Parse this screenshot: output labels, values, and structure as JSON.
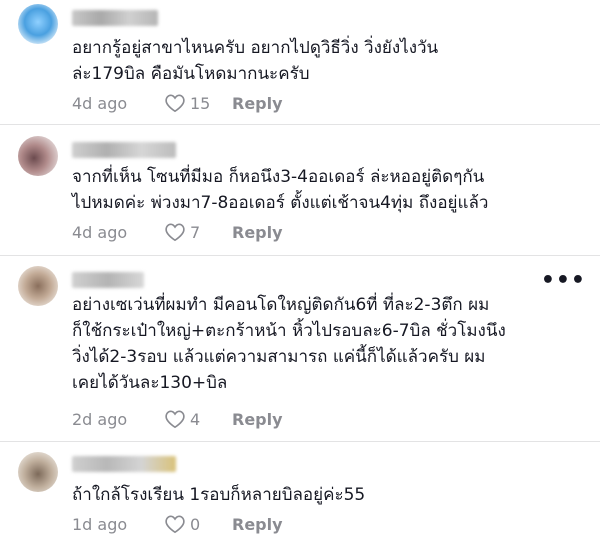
{
  "comments": [
    {
      "text_line1": "อยากรู้อยู่สาขาไหนครับ อยากไปดูวิธีวิ่ง วิ่งยังไงวัน",
      "text_line2": "ล่ะ179บิล คือมันโหดมากนะครับ",
      "time": "4d ago",
      "likes": "15",
      "reply": "Reply",
      "avatar_color": "#5aa9e6"
    },
    {
      "text_line1": "จากที่เห็น โซนที่มีมอ ก็หอนึง3-4ออเดอร์ ล่ะหออยู่ติดๆกัน",
      "text_line2": "ไปหมดค่ะ พ่วงมา7-8ออเดอร์ ตั้งแต่เช้าจน4ทุ่ม ถึงอยู่แล้ว",
      "time": "4d ago",
      "likes": "7",
      "reply": "Reply",
      "avatar_color": "#9a7a78"
    },
    {
      "text_line1": "อย่างเซเว่นที่ผมทำ มีคอนโดใหญ่ติดกัน6ที่ ที่ละ2-3ตึก ผม",
      "text_line2": "ก็ใช้กระเป๋าใหญ่+ตะกร้าหน้า หิ้วไปรอบละ6-7บิล ชั่วโมงนึง",
      "text_line3": "วิ่งได้2-3รอบ แล้วแต่ความสามารถ แค่นี้ก็ได้แล้วครับ ผม",
      "text_line4": "เคยได้วันละ130+บิล",
      "time": "2d ago",
      "likes": "4",
      "reply": "Reply",
      "more": "•••",
      "avatar_color": "#b39a86"
    },
    {
      "text_line1": "ถ้าใกล้โรงเรียน 1รอบก็หลายบิลอยู่ค่ะ55",
      "time": "1d ago",
      "likes": "0",
      "reply": "Reply",
      "avatar_color": "#a59a8a"
    }
  ]
}
